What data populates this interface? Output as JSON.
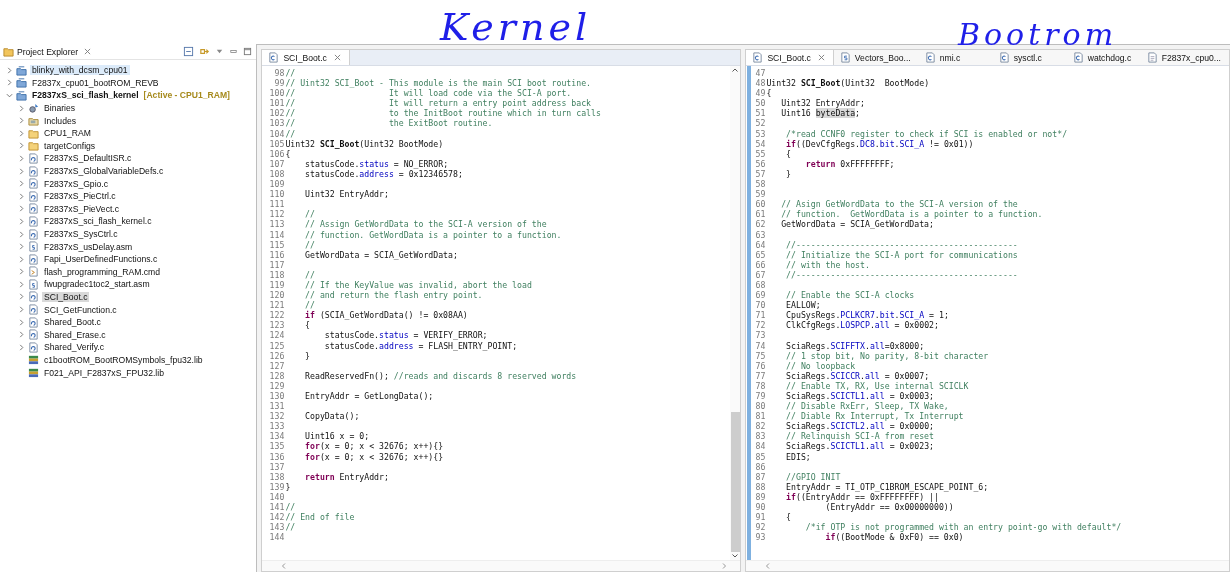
{
  "annotations": [
    {
      "text": "Kernel"
    },
    {
      "text": "Bootrom"
    }
  ],
  "explorer": {
    "title": "Project Explorer",
    "tree": [
      {
        "label": "blinky_with_dcsm_cpu01",
        "kind": "project",
        "expanded": false,
        "selected": false,
        "hovered": true,
        "active": false
      },
      {
        "label": "F2837x_cpu01_bootROM_REVB",
        "kind": "project",
        "expanded": false,
        "selected": false,
        "hovered": false,
        "active": false
      },
      {
        "label": "F2837xS_sci_flash_kernel",
        "tag": "[Active - CPU1_RAM]",
        "kind": "project",
        "expanded": true,
        "selected": false,
        "hovered": false,
        "active": true,
        "children": [
          {
            "label": "Binaries",
            "kind": "binaries",
            "expanded": false,
            "selected": false
          },
          {
            "label": "Includes",
            "kind": "includes",
            "expanded": false,
            "selected": false
          },
          {
            "label": "CPU1_RAM",
            "kind": "folder",
            "expanded": false,
            "selected": false
          },
          {
            "label": "targetConfigs",
            "kind": "folder",
            "expanded": false,
            "selected": false
          },
          {
            "label": "F2837xS_DefaultISR.c",
            "kind": "source",
            "expanded": false,
            "selected": false
          },
          {
            "label": "F2837xS_GlobalVariableDefs.c",
            "kind": "source",
            "expanded": false,
            "selected": false
          },
          {
            "label": "F2837xS_Gpio.c",
            "kind": "source",
            "expanded": false,
            "selected": false
          },
          {
            "label": "F2837xS_PieCtrl.c",
            "kind": "source",
            "expanded": false,
            "selected": false
          },
          {
            "label": "F2837xS_PieVect.c",
            "kind": "source",
            "expanded": false,
            "selected": false
          },
          {
            "label": "F2837xS_sci_flash_kernel.c",
            "kind": "source",
            "expanded": false,
            "selected": false
          },
          {
            "label": "F2837xS_SysCtrl.c",
            "kind": "source",
            "expanded": false,
            "selected": false
          },
          {
            "label": "F2837xS_usDelay.asm",
            "kind": "asm",
            "expanded": false,
            "selected": false
          },
          {
            "label": "Fapi_UserDefinedFunctions.c",
            "kind": "source",
            "expanded": false,
            "selected": false
          },
          {
            "label": "flash_programming_RAM.cmd",
            "kind": "cmd",
            "expanded": false,
            "selected": false
          },
          {
            "label": "fwupgradec1toc2_start.asm",
            "kind": "asm",
            "expanded": false,
            "selected": false
          },
          {
            "label": "SCI_Boot.c",
            "kind": "source",
            "expanded": false,
            "selected": true
          },
          {
            "label": "SCI_GetFunction.c",
            "kind": "source",
            "expanded": false,
            "selected": false
          },
          {
            "label": "Shared_Boot.c",
            "kind": "source",
            "expanded": false,
            "selected": false
          },
          {
            "label": "Shared_Erase.c",
            "kind": "source",
            "expanded": false,
            "selected": false
          },
          {
            "label": "Shared_Verify.c",
            "kind": "source",
            "expanded": false,
            "selected": false
          },
          {
            "label": "c1bootROM_BootROMSymbols_fpu32.lib",
            "kind": "library",
            "selected": false
          },
          {
            "label": "F021_API_F2837xS_FPU32.lib",
            "kind": "library",
            "selected": false
          }
        ]
      }
    ]
  },
  "editors": [
    {
      "tabs": [
        {
          "label": "SCI_Boot.c",
          "kind": "c",
          "selected": true
        }
      ],
      "lines": [
        {
          "number": "98",
          "parts": [
            {
              "text": "//",
              "kind": "comment"
            }
          ]
        },
        {
          "number": "99",
          "parts": [
            {
              "text": "// Uint32 SCI_Boot - This module is the main SCI boot routine.",
              "kind": "comment"
            }
          ]
        },
        {
          "number": "100",
          "parts": [
            {
              "text": "//                   It will load code via the SCI-A port.",
              "kind": "comment"
            }
          ]
        },
        {
          "number": "101",
          "parts": [
            {
              "text": "//                   It will return a entry point address back",
              "kind": "comment"
            }
          ]
        },
        {
          "number": "102",
          "parts": [
            {
              "text": "//                   to the InitBoot routine which in turn calls",
              "kind": "comment"
            }
          ]
        },
        {
          "number": "103",
          "parts": [
            {
              "text": "//                   the ExitBoot routine.",
              "kind": "comment"
            }
          ]
        },
        {
          "number": "104",
          "parts": [
            {
              "text": "//",
              "kind": "comment"
            }
          ]
        },
        {
          "number": "105",
          "parts": [
            {
              "text": "Uint32 ",
              "kind": "plain"
            },
            {
              "text": "SCI_Boot",
              "kind": "bold"
            },
            {
              "text": "(Uint32 BootMode)",
              "kind": "plain"
            }
          ]
        },
        {
          "number": "106",
          "parts": [
            {
              "text": "{",
              "kind": "plain"
            }
          ]
        },
        {
          "number": "107",
          "parts": [
            {
              "text": "    statusCode.",
              "kind": "plain"
            },
            {
              "text": "status",
              "kind": "field"
            },
            {
              "text": " = NO_ERROR;",
              "kind": "plain"
            }
          ]
        },
        {
          "number": "108",
          "parts": [
            {
              "text": "    statusCode.",
              "kind": "plain"
            },
            {
              "text": "address",
              "kind": "field"
            },
            {
              "text": " = 0x12346578;",
              "kind": "plain"
            }
          ]
        },
        {
          "number": "109"
        },
        {
          "number": "110",
          "parts": [
            {
              "text": "    Uint32 EntryAddr;",
              "kind": "plain"
            }
          ]
        },
        {
          "number": "111"
        },
        {
          "number": "112",
          "parts": [
            {
              "text": "    //",
              "kind": "comment"
            }
          ]
        },
        {
          "number": "113",
          "parts": [
            {
              "text": "    // Assign GetWordData to the SCI-A version of the",
              "kind": "comment"
            }
          ]
        },
        {
          "number": "114",
          "parts": [
            {
              "text": "    // function. GetWordData is a pointer to a function.",
              "kind": "comment"
            }
          ]
        },
        {
          "number": "115",
          "parts": [
            {
              "text": "    //",
              "kind": "comment"
            }
          ]
        },
        {
          "number": "116",
          "parts": [
            {
              "text": "    GetWordData = SCIA_GetWordData;",
              "kind": "plain"
            }
          ]
        },
        {
          "number": "117"
        },
        {
          "number": "118",
          "parts": [
            {
              "text": "    //",
              "kind": "comment"
            }
          ]
        },
        {
          "number": "119",
          "parts": [
            {
              "text": "    // If the KeyValue was invalid, abort the load",
              "kind": "comment"
            }
          ]
        },
        {
          "number": "120",
          "parts": [
            {
              "text": "    // and return the flash entry point.",
              "kind": "comment"
            }
          ]
        },
        {
          "number": "121",
          "parts": [
            {
              "text": "    //",
              "kind": "comment"
            }
          ]
        },
        {
          "number": "122",
          "parts": [
            {
              "text": "    if",
              "kind": "keyword"
            },
            {
              "text": " (SCIA_GetWordData() != 0x08AA)",
              "kind": "plain"
            }
          ]
        },
        {
          "number": "123",
          "parts": [
            {
              "text": "    {",
              "kind": "plain"
            }
          ]
        },
        {
          "number": "124",
          "parts": [
            {
              "text": "        statusCode.",
              "kind": "plain"
            },
            {
              "text": "status",
              "kind": "field"
            },
            {
              "text": " = VERIFY_ERROR;",
              "kind": "plain"
            }
          ]
        },
        {
          "number": "125",
          "parts": [
            {
              "text": "        statusCode.",
              "kind": "plain"
            },
            {
              "text": "address",
              "kind": "field"
            },
            {
              "text": " = FLASH_ENTRY_POINT;",
              "kind": "plain"
            }
          ]
        },
        {
          "number": "126",
          "parts": [
            {
              "text": "    }",
              "kind": "plain"
            }
          ]
        },
        {
          "number": "127"
        },
        {
          "number": "128",
          "parts": [
            {
              "text": "    ReadReservedFn(); ",
              "kind": "plain"
            },
            {
              "text": "//reads and discards 8 reserved words",
              "kind": "comment"
            }
          ]
        },
        {
          "number": "129"
        },
        {
          "number": "130",
          "parts": [
            {
              "text": "    EntryAddr = GetLongData();",
              "kind": "plain"
            }
          ]
        },
        {
          "number": "131"
        },
        {
          "number": "132",
          "parts": [
            {
              "text": "    CopyData();",
              "kind": "plain"
            }
          ]
        },
        {
          "number": "133"
        },
        {
          "number": "134",
          "parts": [
            {
              "text": "    Uint16 x = 0;",
              "kind": "plain"
            }
          ]
        },
        {
          "number": "135",
          "parts": [
            {
              "text": "    for",
              "kind": "keyword"
            },
            {
              "text": "(x = 0; x < 32676; x++){}",
              "kind": "plain"
            }
          ]
        },
        {
          "number": "136",
          "parts": [
            {
              "text": "    for",
              "kind": "keyword"
            },
            {
              "text": "(x = 0; x < 32676; x++){}",
              "kind": "plain"
            }
          ]
        },
        {
          "number": "137"
        },
        {
          "number": "138",
          "parts": [
            {
              "text": "    return",
              "kind": "keyword"
            },
            {
              "text": " EntryAddr;",
              "kind": "plain"
            }
          ]
        },
        {
          "number": "139",
          "parts": [
            {
              "text": "}",
              "kind": "plain"
            }
          ]
        },
        {
          "number": "140"
        },
        {
          "number": "141",
          "parts": [
            {
              "text": "//",
              "kind": "comment"
            }
          ]
        },
        {
          "number": "142",
          "parts": [
            {
              "text": "// End of file",
              "kind": "comment"
            }
          ]
        },
        {
          "number": "143",
          "parts": [
            {
              "text": "//",
              "kind": "comment"
            }
          ]
        },
        {
          "number": "144"
        }
      ]
    },
    {
      "tabs": [
        {
          "label": "SCI_Boot.c",
          "kind": "c",
          "selected": true
        },
        {
          "label": "Vectors_Boo...",
          "kind": "asm",
          "selected": false
        },
        {
          "label": "nmi.c",
          "kind": "c",
          "selected": false
        },
        {
          "label": "sysctl.c",
          "kind": "c",
          "selected": false
        },
        {
          "label": "watchdog.c",
          "kind": "c",
          "selected": false
        },
        {
          "label": "F2837x_cpu0...",
          "kind": "file",
          "selected": false
        }
      ],
      "lines": [
        {
          "number": "47"
        },
        {
          "number": "48",
          "parts": [
            {
              "text": "Uint32 ",
              "kind": "plain"
            },
            {
              "text": "SCI_Boot",
              "kind": "bold"
            },
            {
              "text": "(Uint32  BootMode)",
              "kind": "plain"
            }
          ]
        },
        {
          "number": "49",
          "parts": [
            {
              "text": "{",
              "kind": "plain"
            }
          ]
        },
        {
          "number": "50",
          "parts": [
            {
              "text": "   Uint32 EntryAddr;",
              "kind": "plain"
            }
          ]
        },
        {
          "number": "51",
          "parts": [
            {
              "text": "   Uint16 ",
              "kind": "plain"
            },
            {
              "text": "byteData",
              "kind": "marked"
            },
            {
              "text": ";",
              "kind": "plain"
            }
          ]
        },
        {
          "number": "52"
        },
        {
          "number": "53",
          "parts": [
            {
              "text": "    /*read CCNF0 register to check if SCI is enabled or not*/",
              "kind": "comment"
            }
          ]
        },
        {
          "number": "54",
          "parts": [
            {
              "text": "    if",
              "kind": "keyword"
            },
            {
              "text": "((DevCfgRegs.",
              "kind": "plain"
            },
            {
              "text": "DC8",
              "kind": "field"
            },
            {
              "text": ".",
              "kind": "plain"
            },
            {
              "text": "bit",
              "kind": "field"
            },
            {
              "text": ".",
              "kind": "plain"
            },
            {
              "text": "SCI_A",
              "kind": "field"
            },
            {
              "text": " != 0x01))",
              "kind": "plain"
            }
          ]
        },
        {
          "number": "55",
          "parts": [
            {
              "text": "    {",
              "kind": "plain"
            }
          ]
        },
        {
          "number": "56",
          "parts": [
            {
              "text": "        return",
              "kind": "keyword"
            },
            {
              "text": " 0xFFFFFFFF;",
              "kind": "plain"
            }
          ]
        },
        {
          "number": "57",
          "parts": [
            {
              "text": "    }",
              "kind": "plain"
            }
          ]
        },
        {
          "number": "58"
        },
        {
          "number": "59"
        },
        {
          "number": "60",
          "parts": [
            {
              "text": "   // Asign GetWordData to the SCI-A version of the",
              "kind": "comment"
            }
          ]
        },
        {
          "number": "61",
          "parts": [
            {
              "text": "   // function.  GetWordData is a pointer to a function.",
              "kind": "comment"
            }
          ]
        },
        {
          "number": "62",
          "parts": [
            {
              "text": "   GetWordData = SCIA_GetWordData;",
              "kind": "plain"
            }
          ]
        },
        {
          "number": "63"
        },
        {
          "number": "64",
          "parts": [
            {
              "text": "    //---------------------------------------------",
              "kind": "comment"
            }
          ]
        },
        {
          "number": "65",
          "parts": [
            {
              "text": "    // Initialize the SCI-A port for communications",
              "kind": "comment"
            }
          ]
        },
        {
          "number": "66",
          "parts": [
            {
              "text": "    // with the host.",
              "kind": "comment"
            }
          ]
        },
        {
          "number": "67",
          "parts": [
            {
              "text": "    //---------------------------------------------",
              "kind": "comment"
            }
          ]
        },
        {
          "number": "68"
        },
        {
          "number": "69",
          "parts": [
            {
              "text": "    // Enable the SCI-A clocks",
              "kind": "comment"
            }
          ]
        },
        {
          "number": "70",
          "parts": [
            {
              "text": "    EALLOW;",
              "kind": "plain"
            }
          ]
        },
        {
          "number": "71",
          "parts": [
            {
              "text": "    CpuSysRegs.",
              "kind": "plain"
            },
            {
              "text": "PCLKCR7",
              "kind": "field"
            },
            {
              "text": ".",
              "kind": "plain"
            },
            {
              "text": "bit",
              "kind": "field"
            },
            {
              "text": ".",
              "kind": "plain"
            },
            {
              "text": "SCI_A",
              "kind": "field"
            },
            {
              "text": " = 1;",
              "kind": "plain"
            }
          ]
        },
        {
          "number": "72",
          "parts": [
            {
              "text": "    ClkCfgRegs.",
              "kind": "plain"
            },
            {
              "text": "LOSPCP",
              "kind": "field"
            },
            {
              "text": ".",
              "kind": "plain"
            },
            {
              "text": "all",
              "kind": "field"
            },
            {
              "text": " = 0x0002;",
              "kind": "plain"
            }
          ]
        },
        {
          "number": "73"
        },
        {
          "number": "74",
          "parts": [
            {
              "text": "    SciaRegs.",
              "kind": "plain"
            },
            {
              "text": "SCIFFTX",
              "kind": "field"
            },
            {
              "text": ".",
              "kind": "plain"
            },
            {
              "text": "all",
              "kind": "field"
            },
            {
              "text": "=0x8000;",
              "kind": "plain"
            }
          ]
        },
        {
          "number": "75",
          "parts": [
            {
              "text": "    // 1 stop bit, No parity, 8-bit character",
              "kind": "comment"
            }
          ]
        },
        {
          "number": "76",
          "parts": [
            {
              "text": "    // No loopback",
              "kind": "comment"
            }
          ]
        },
        {
          "number": "77",
          "parts": [
            {
              "text": "    SciaRegs.",
              "kind": "plain"
            },
            {
              "text": "SCICCR",
              "kind": "field"
            },
            {
              "text": ".",
              "kind": "plain"
            },
            {
              "text": "all",
              "kind": "field"
            },
            {
              "text": " = 0x0007;",
              "kind": "plain"
            }
          ]
        },
        {
          "number": "78",
          "parts": [
            {
              "text": "    // Enable TX, RX, Use internal SCICLK",
              "kind": "comment"
            }
          ]
        },
        {
          "number": "79",
          "parts": [
            {
              "text": "    SciaRegs.",
              "kind": "plain"
            },
            {
              "text": "SCICTL1",
              "kind": "field"
            },
            {
              "text": ".",
              "kind": "plain"
            },
            {
              "text": "all",
              "kind": "field"
            },
            {
              "text": " = 0x0003;",
              "kind": "plain"
            }
          ]
        },
        {
          "number": "80",
          "parts": [
            {
              "text": "    // Disable RxErr, Sleep, TX Wake,",
              "kind": "comment"
            }
          ]
        },
        {
          "number": "81",
          "parts": [
            {
              "text": "    // Diable Rx Interrupt, Tx Interrupt",
              "kind": "comment"
            }
          ]
        },
        {
          "number": "82",
          "parts": [
            {
              "text": "    SciaRegs.",
              "kind": "plain"
            },
            {
              "text": "SCICTL2",
              "kind": "field"
            },
            {
              "text": ".",
              "kind": "plain"
            },
            {
              "text": "all",
              "kind": "field"
            },
            {
              "text": " = 0x0000;",
              "kind": "plain"
            }
          ]
        },
        {
          "number": "83",
          "parts": [
            {
              "text": "    // Relinquish SCI-A from reset",
              "kind": "comment"
            }
          ]
        },
        {
          "number": "84",
          "parts": [
            {
              "text": "    SciaRegs.",
              "kind": "plain"
            },
            {
              "text": "SCICTL1",
              "kind": "field"
            },
            {
              "text": ".",
              "kind": "plain"
            },
            {
              "text": "all",
              "kind": "field"
            },
            {
              "text": " = 0x0023;",
              "kind": "plain"
            }
          ]
        },
        {
          "number": "85",
          "parts": [
            {
              "text": "    EDIS;",
              "kind": "plain"
            }
          ]
        },
        {
          "number": "86"
        },
        {
          "number": "87",
          "parts": [
            {
              "text": "    //GPIO INIT",
              "kind": "comment"
            }
          ]
        },
        {
          "number": "88",
          "parts": [
            {
              "text": "    EntryAddr = TI_OTP_C1BROM_ESCAPE_POINT_6;",
              "kind": "plain"
            }
          ]
        },
        {
          "number": "89",
          "parts": [
            {
              "text": "    if",
              "kind": "keyword"
            },
            {
              "text": "((EntryAddr == 0xFFFFFFFF) ||",
              "kind": "plain"
            }
          ]
        },
        {
          "number": "90",
          "parts": [
            {
              "text": "            (EntryAddr == 0x00000000))",
              "kind": "plain"
            }
          ]
        },
        {
          "number": "91",
          "parts": [
            {
              "text": "    {",
              "kind": "plain"
            }
          ]
        },
        {
          "number": "92",
          "parts": [
            {
              "text": "        /*if OTP is not programmed with an entry point-go with default*/",
              "kind": "comment"
            }
          ]
        },
        {
          "number": "93",
          "parts": [
            {
              "text": "            if",
              "kind": "keyword"
            },
            {
              "text": "((BootMode & 0xF0) == 0x0)",
              "kind": "plain"
            }
          ]
        }
      ]
    }
  ]
}
